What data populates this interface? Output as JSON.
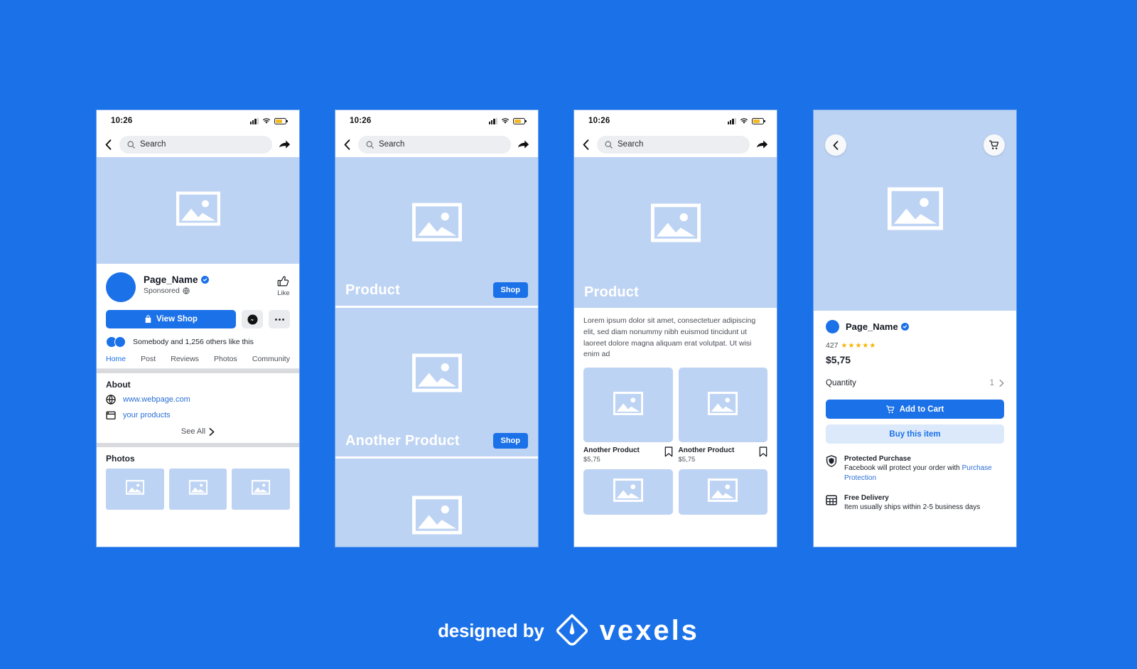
{
  "meta": {
    "background_color": "#1b71e8",
    "accent_color": "#1b71e8",
    "placeholder_color": "#bdd3f3",
    "star_color": "#f5b301"
  },
  "status_bar": {
    "time": "10:26"
  },
  "nav": {
    "search_placeholder": "Search"
  },
  "screen1": {
    "page_name": "Page_Name",
    "sponsored": "Sponsored",
    "like_label": "Like",
    "view_shop": "View Shop",
    "likes_text": "Somebody and 1,256 others like this",
    "tabs": [
      {
        "label": "Home",
        "active": true
      },
      {
        "label": "Post",
        "active": false
      },
      {
        "label": "Reviews",
        "active": false
      },
      {
        "label": "Photos",
        "active": false
      },
      {
        "label": "Community",
        "active": false
      }
    ],
    "about_title": "About",
    "about_links": [
      {
        "icon": "globe-icon",
        "label": "www.webpage.com"
      },
      {
        "icon": "store-icon",
        "label": "your products"
      }
    ],
    "see_all": "See All",
    "photos_title": "Photos",
    "photos_count": 3
  },
  "screen2": {
    "products": [
      {
        "name": "Product",
        "cta": "Shop"
      },
      {
        "name": "Another Product",
        "cta": "Shop"
      },
      {
        "name": "",
        "cta": ""
      }
    ]
  },
  "screen3": {
    "hero_title": "Product",
    "description": "Lorem ipsum dolor sit amet, consectetuer adipiscing elit, sed diam nonummy nibh euismod tincidunt ut laoreet dolore magna aliquam erat volutpat. Ut wisi enim ad",
    "grid_items": [
      {
        "name": "Another Product",
        "price": "$5,75"
      },
      {
        "name": "Another Product",
        "price": "$5,75"
      },
      {
        "name": "",
        "price": ""
      },
      {
        "name": "",
        "price": ""
      }
    ]
  },
  "screen4": {
    "page_name": "Page_Name",
    "review_count": "427",
    "stars": "★★★★★",
    "price": "$5,75",
    "quantity_label": "Quantity",
    "quantity_value": "1",
    "add_to_cart": "Add to Cart",
    "buy_this_item": "Buy this item",
    "info": [
      {
        "icon": "shield-icon",
        "title": "Protected Purchase",
        "body_before": "Facebook will protect your order with ",
        "link": "Purchase Protection",
        "body_after": ""
      },
      {
        "icon": "calendar-icon",
        "title": "Free Delivery",
        "body_before": "Item usually ships within 2-5 business days",
        "link": "",
        "body_after": ""
      }
    ]
  },
  "footer": {
    "designed_by": "designed by",
    "brand": "vexels"
  }
}
